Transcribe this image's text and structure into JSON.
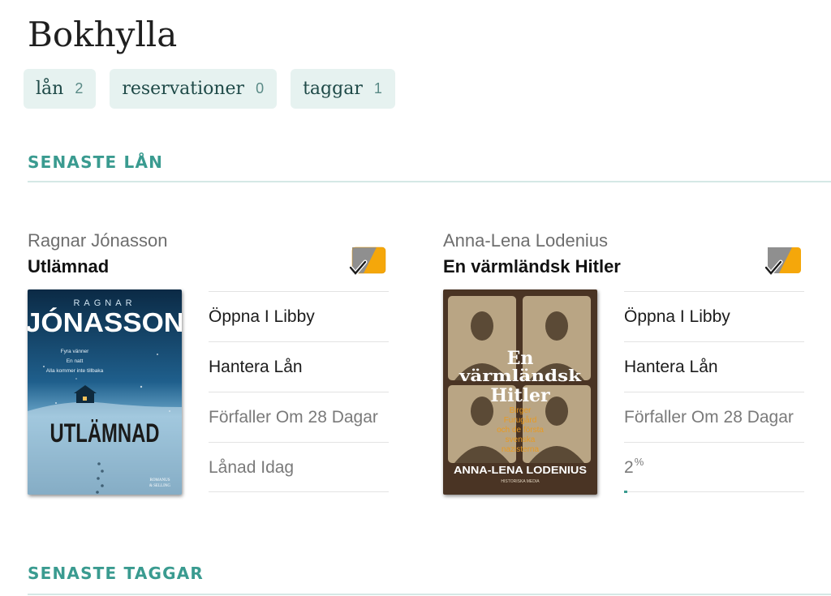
{
  "page": {
    "title": "Bokhylla"
  },
  "tabs": [
    {
      "label": "lån",
      "count": "2"
    },
    {
      "label": "reservationer",
      "count": "0"
    },
    {
      "label": "taggar",
      "count": "1"
    }
  ],
  "sections": {
    "recent_loans": "SENASTE LÅN",
    "recent_tags": "SENASTE TAGGAR"
  },
  "loans": [
    {
      "author": "Ragnar Jónasson",
      "title": "Utlämnad",
      "cover": {
        "author_small": "RAGNAR",
        "author_big": "JÓNASSON",
        "tagline": [
          "Fyra vänner",
          "En natt",
          "Alla kommer inte tillbaka"
        ],
        "title": "UTLÄMNAD",
        "publisher": [
          "ROMANUS",
          "& SELLING"
        ]
      },
      "actions": {
        "open": "Öppna I Libby",
        "manage": "Hantera Lån"
      },
      "due": "Förfaller Om 28 Dagar",
      "status": "Lånad Idag"
    },
    {
      "author": "Anna-Lena Lodenius",
      "title": "En värmländsk Hitler",
      "cover": {
        "title": [
          "En",
          "värmländsk",
          "Hitler"
        ],
        "subtitle": [
          "Birger",
          "Furugård",
          "och de första",
          "svenska",
          "nazisterna"
        ],
        "author": "ANNA-LENA LODENIUS",
        "publisher": "HISTORISKA MEDIA"
      },
      "actions": {
        "open": "Öppna I Libby",
        "manage": "Hantera Lån"
      },
      "due": "Förfaller Om 28 Dagar",
      "progress": {
        "value": "2",
        "unit": "%",
        "fraction": 0.02
      }
    }
  ],
  "colors": {
    "accent": "#3a9b90",
    "tab_bg": "#e6f2f0",
    "status_icon_orange": "#f5a70a",
    "status_icon_grey": "#8f8f8f"
  },
  "icons": {
    "status": "returned-check-tag-icon"
  }
}
